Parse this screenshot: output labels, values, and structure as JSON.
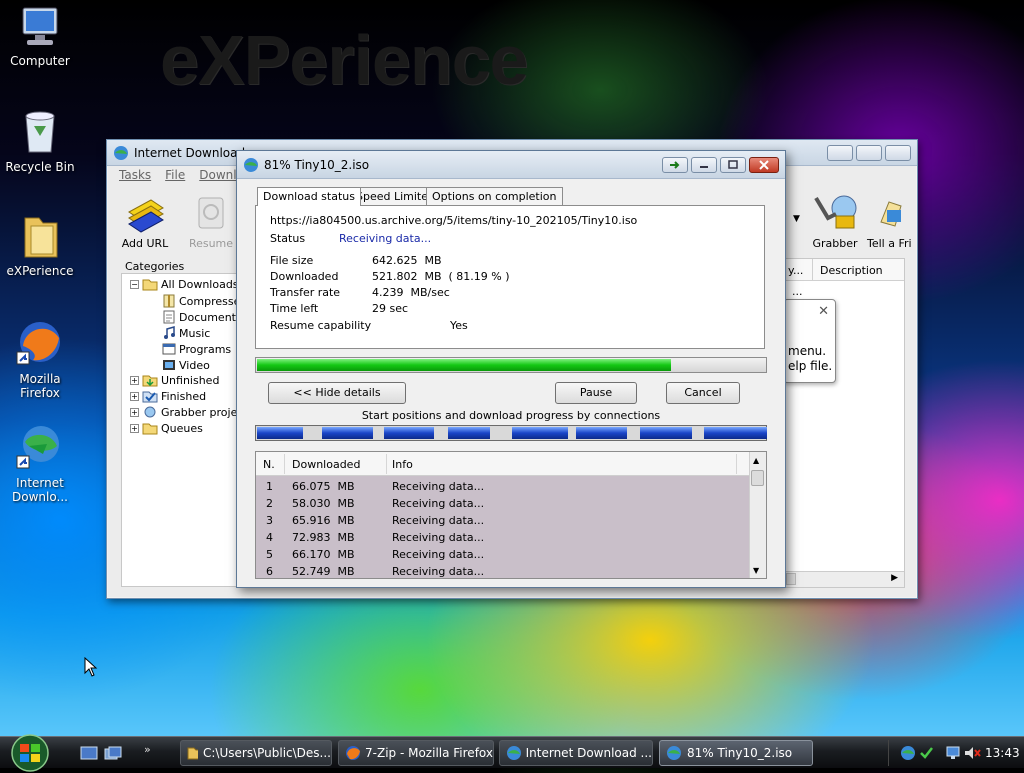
{
  "desktop": {
    "wallpaper_text": "eXPerience",
    "icons": [
      {
        "label": "Computer"
      },
      {
        "label": "Recycle Bin"
      },
      {
        "label": "eXPerience"
      },
      {
        "label": "Mozilla Firefox"
      },
      {
        "label": "Internet Downlo..."
      }
    ]
  },
  "main_window": {
    "title": "Internet Download",
    "menu": [
      "Tasks",
      "File",
      "Downlo"
    ],
    "toolbar": {
      "add_url": "Add URL",
      "resume": "Resume",
      "grabber": "Grabber",
      "tell_friend": "Tell a Fri"
    },
    "categories_label": "Categories",
    "tree": [
      {
        "label": "All Downloads"
      },
      {
        "label": "Compresse"
      },
      {
        "label": "Documents"
      },
      {
        "label": "Music"
      },
      {
        "label": "Programs"
      },
      {
        "label": "Video"
      },
      {
        "label": "Unfinished"
      },
      {
        "label": "Finished"
      },
      {
        "label": "Grabber projec"
      },
      {
        "label": "Queues"
      }
    ],
    "column_description": "Description",
    "column_partial": "y...",
    "row_partial": "...",
    "tooltip_line1": "menu.",
    "tooltip_line2": "elp file."
  },
  "dialog": {
    "title": "81% Tiny10_2.iso",
    "tabs": [
      "Download status",
      "Speed Limiter",
      "Options on completion"
    ],
    "url": "https://ia804500.us.archive.org/5/items/tiny-10_202105/Tiny10.iso",
    "status_label": "Status",
    "status_value": "Receiving data...",
    "file_size_label": "File size",
    "file_size_value": "642.625  MB",
    "downloaded_label": "Downloaded",
    "downloaded_value": "521.802  MB  ( 81.19 % )",
    "transfer_rate_label": "Transfer rate",
    "transfer_rate_value": "4.239  MB/sec",
    "time_left_label": "Time left",
    "time_left_value": "29 sec",
    "resume_label": "Resume capability",
    "resume_value": "Yes",
    "progress_fraction": 0.8119,
    "hide_details": "<< Hide details",
    "pause": "Pause",
    "cancel": "Cancel",
    "connections_caption": "Start positions and download progress by connections",
    "table": {
      "headers": [
        "N.",
        "Downloaded",
        "Info"
      ],
      "rows": [
        {
          "n": "1",
          "downloaded": "66.075  MB",
          "info": "Receiving data..."
        },
        {
          "n": "2",
          "downloaded": "58.030  MB",
          "info": "Receiving data..."
        },
        {
          "n": "3",
          "downloaded": "65.916  MB",
          "info": "Receiving data..."
        },
        {
          "n": "4",
          "downloaded": "72.983  MB",
          "info": "Receiving data..."
        },
        {
          "n": "5",
          "downloaded": "66.170  MB",
          "info": "Receiving data..."
        },
        {
          "n": "6",
          "downloaded": "52.749  MB",
          "info": "Receiving data..."
        }
      ]
    }
  },
  "taskbar": {
    "tasks": [
      {
        "label": "C:\\Users\\Public\\Des..."
      },
      {
        "label": "7-Zip - Mozilla Firefox"
      },
      {
        "label": "Internet Download ..."
      },
      {
        "label": "81% Tiny10_2.iso"
      }
    ],
    "clock": "13:43"
  }
}
